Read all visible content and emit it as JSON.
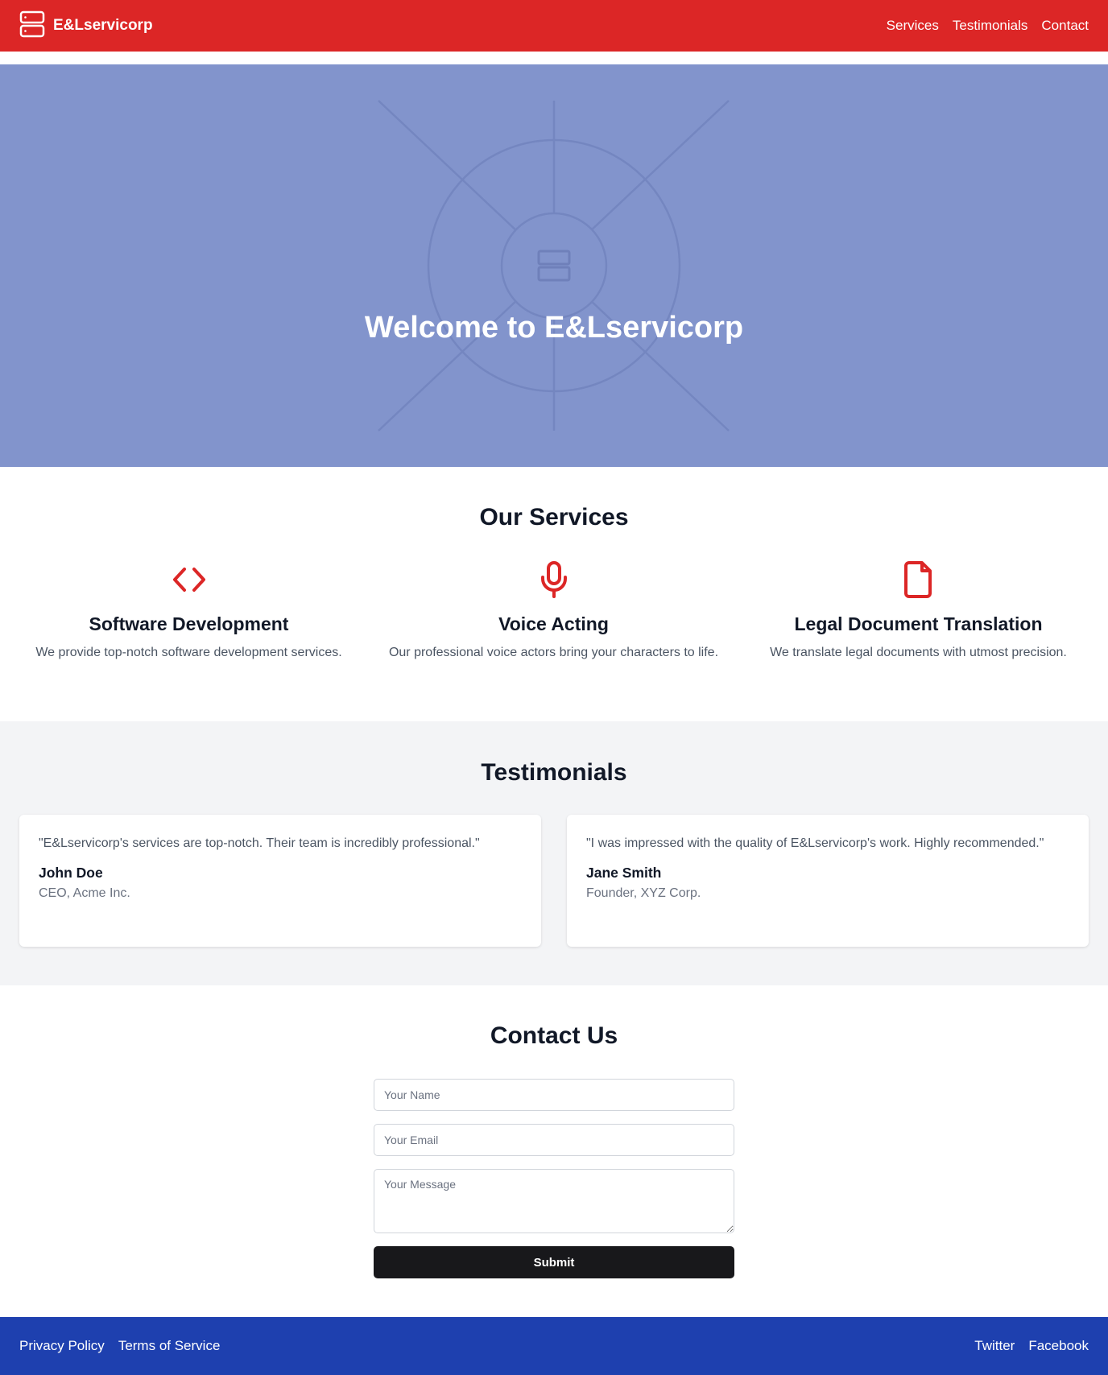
{
  "header": {
    "brand": "E&Lservicorp",
    "nav": [
      "Services",
      "Testimonials",
      "Contact"
    ]
  },
  "hero": {
    "title": "Welcome to E&Lservicorp"
  },
  "services": {
    "title": "Our Services",
    "items": [
      {
        "icon": "code-icon",
        "title": "Software Development",
        "description": "We provide top-notch software development services."
      },
      {
        "icon": "microphone-icon",
        "title": "Voice Acting",
        "description": "Our professional voice actors bring your characters to life."
      },
      {
        "icon": "document-icon",
        "title": "Legal Document Translation",
        "description": "We translate legal documents with utmost precision."
      }
    ]
  },
  "testimonials": {
    "title": "Testimonials",
    "items": [
      {
        "quote": "\"E&Lservicorp's services are top-notch. Their team is incredibly professional.\"",
        "name": "John Doe",
        "role": "CEO, Acme Inc."
      },
      {
        "quote": "\"I was impressed with the quality of E&Lservicorp's work. Highly recommended.\"",
        "name": "Jane Smith",
        "role": "Founder, XYZ Corp."
      }
    ]
  },
  "contact": {
    "title": "Contact Us",
    "name_placeholder": "Your Name",
    "email_placeholder": "Your Email",
    "message_placeholder": "Your Message",
    "submit_label": "Submit"
  },
  "footer": {
    "left_links": [
      "Privacy Policy",
      "Terms of Service"
    ],
    "right_links": [
      "Twitter",
      "Facebook"
    ]
  },
  "colors": {
    "header_bg": "#dc2626",
    "hero_bg": "#8294cc",
    "accent_icon": "#dc2626",
    "testimonials_bg": "#f3f4f6",
    "submit_bg": "#18181b",
    "footer_bg": "#1e40af"
  }
}
